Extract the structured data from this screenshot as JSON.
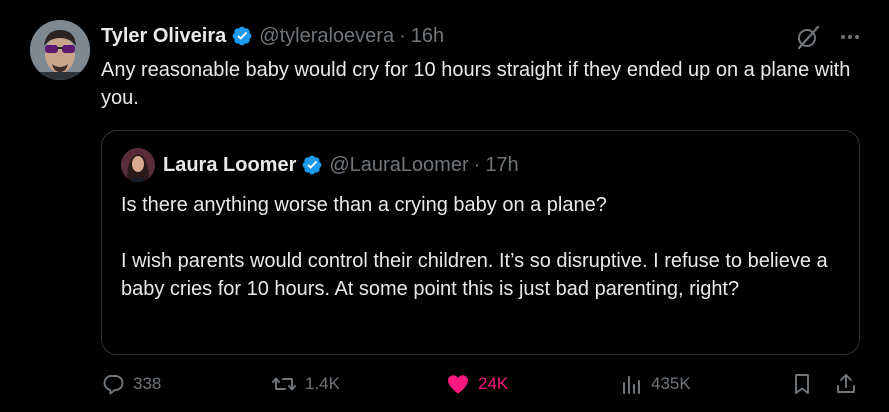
{
  "tweet": {
    "author_name": "Tyler Oliveira",
    "author_handle": "@tyleraloevera",
    "separator": "·",
    "time": "16h",
    "text": "Any reasonable baby would cry for 10 hours straight if they ended up on a plane with you."
  },
  "quote": {
    "author_name": "Laura Loomer",
    "author_handle": "@LauraLoomer",
    "separator": "·",
    "time": "17h",
    "paragraphs": [
      "Is there anything worse than a crying baby on a plane?",
      "I wish parents would control their children. It’s so disruptive. I refuse to believe a baby cries for 10 hours. At some point this is just bad parenting, right?"
    ]
  },
  "actions": {
    "replies": "338",
    "reposts": "1.4K",
    "likes": "24K",
    "views": "435K"
  },
  "colors": {
    "background": "#000000",
    "text": "#e7e9ea",
    "muted": "#71767b",
    "verified": "#1d9bf0",
    "like": "#f91880",
    "border": "#2f3336"
  },
  "icons": [
    "verified-badge-icon",
    "grok-icon",
    "more-icon",
    "reply-icon",
    "repost-icon",
    "like-icon",
    "views-icon",
    "bookmark-icon",
    "share-icon"
  ]
}
